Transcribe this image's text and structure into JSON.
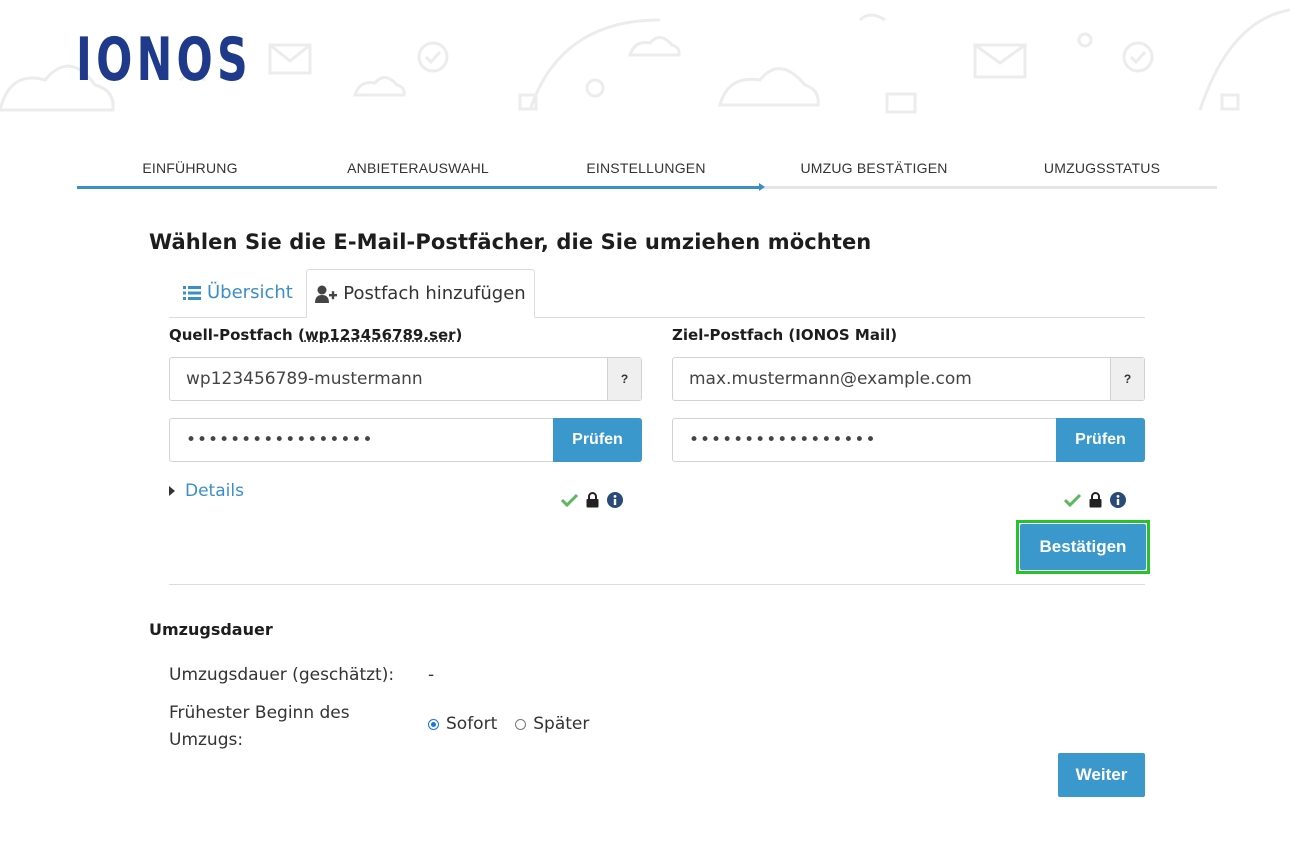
{
  "brand": {
    "logo_text": "IONOS",
    "color": "#1f3a8a"
  },
  "steps": [
    "EINFÜHRUNG",
    "ANBIETERAUSWAHL",
    "EINSTELLUNGEN",
    "UMZUG BESTÄTIGEN",
    "UMZUGSSTATUS"
  ],
  "page_title": "Wählen Sie die E-Mail-Postfächer, die Sie umziehen möchten",
  "tabs": {
    "overview": "Übersicht",
    "add_mailbox": "Postfach hinzufügen"
  },
  "source": {
    "label_prefix": "Quell-Postfach (",
    "label_host": "wp123456789.ser",
    "label_suffix": ")",
    "username": "wp123456789-mustermann",
    "password_mask": "•••••••••••••••••",
    "help": "?",
    "check_label": "Prüfen"
  },
  "target": {
    "label": "Ziel-Postfach (IONOS Mail)",
    "email": "max.mustermann@example.com",
    "password_mask": "•••••••••••••••••",
    "help": "?",
    "check_label": "Prüfen"
  },
  "details_label": "Details",
  "confirm_label": "Bestätigen",
  "duration": {
    "section_title": "Umzugsdauer",
    "estimated_label": "Umzugsdauer (geschätzt):",
    "estimated_value": "-",
    "start_label_line1": "Frühester Beginn des",
    "start_label_line2": "Umzugs:",
    "options": [
      "Sofort",
      "Später"
    ],
    "selected": "Sofort"
  },
  "next_label": "Weiter",
  "colors": {
    "accent": "#3a98cc",
    "success": "#5cb85c",
    "highlight": "#27c32a"
  }
}
